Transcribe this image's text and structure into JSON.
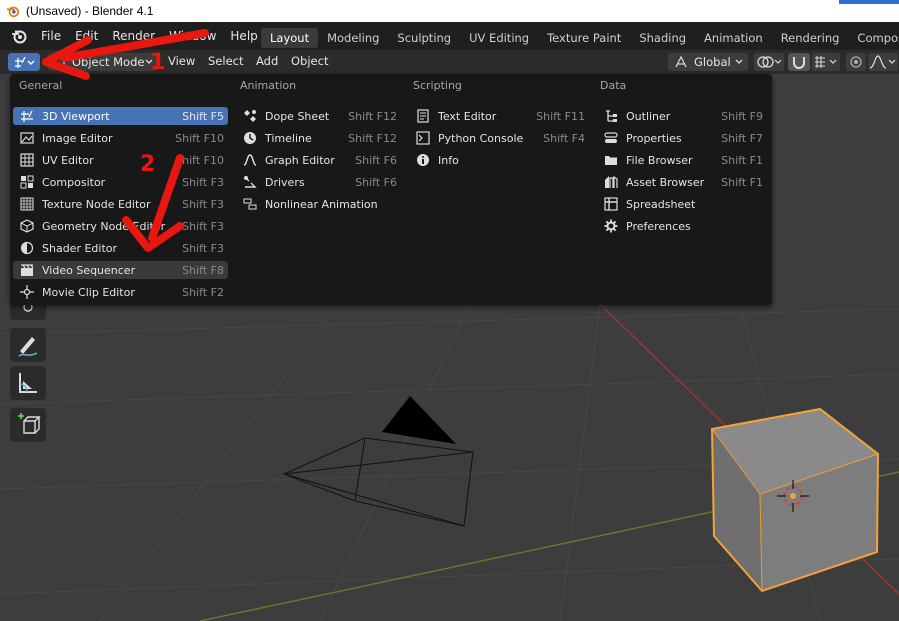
{
  "window": {
    "title": "(Unsaved) - Blender 4.1"
  },
  "topmenu": {
    "items": [
      "File",
      "Edit",
      "Render",
      "Window",
      "Help"
    ]
  },
  "workspaces": {
    "tabs": [
      "Layout",
      "Modeling",
      "Sculpting",
      "UV Editing",
      "Texture Paint",
      "Shading",
      "Animation",
      "Rendering",
      "Compositing"
    ],
    "active": "Layout"
  },
  "header3d": {
    "mode": "Object Mode",
    "menus": [
      "View",
      "Select",
      "Add",
      "Object"
    ],
    "orientation": "Global"
  },
  "editor_menu": {
    "columns": [
      {
        "title": "General",
        "items": [
          {
            "label": "3D Viewport",
            "shortcut": "Shift F5",
            "icon": "viewport-3d-icon",
            "state": "active"
          },
          {
            "label": "Image Editor",
            "shortcut": "Shift F10",
            "icon": "image-editor-icon"
          },
          {
            "label": "UV Editor",
            "shortcut": "Shift F10",
            "icon": "uv-editor-icon"
          },
          {
            "label": "Compositor",
            "shortcut": "Shift F3",
            "icon": "compositor-icon"
          },
          {
            "label": "Texture Node Editor",
            "shortcut": "Shift F3",
            "icon": "texture-node-icon"
          },
          {
            "label": "Geometry Node Editor",
            "shortcut": "Shift F3",
            "icon": "geometry-node-icon"
          },
          {
            "label": "Shader Editor",
            "shortcut": "Shift F3",
            "icon": "shader-editor-icon"
          },
          {
            "label": "Video Sequencer",
            "shortcut": "Shift F8",
            "icon": "video-sequencer-icon",
            "state": "hover"
          },
          {
            "label": "Movie Clip Editor",
            "shortcut": "Shift F2",
            "icon": "movie-clip-icon"
          }
        ]
      },
      {
        "title": "Animation",
        "items": [
          {
            "label": "Dope Sheet",
            "shortcut": "Shift F12",
            "icon": "dope-sheet-icon"
          },
          {
            "label": "Timeline",
            "shortcut": "Shift F12",
            "icon": "timeline-icon"
          },
          {
            "label": "Graph Editor",
            "shortcut": "Shift F6",
            "icon": "graph-editor-icon"
          },
          {
            "label": "Drivers",
            "shortcut": "Shift F6",
            "icon": "drivers-icon"
          },
          {
            "label": "Nonlinear Animation",
            "shortcut": "",
            "icon": "nla-icon"
          }
        ]
      },
      {
        "title": "Scripting",
        "items": [
          {
            "label": "Text Editor",
            "shortcut": "Shift F11",
            "icon": "text-editor-icon"
          },
          {
            "label": "Python Console",
            "shortcut": "Shift F4",
            "icon": "python-console-icon"
          },
          {
            "label": "Info",
            "shortcut": "",
            "icon": "info-icon"
          }
        ]
      },
      {
        "title": "Data",
        "items": [
          {
            "label": "Outliner",
            "shortcut": "Shift F9",
            "icon": "outliner-icon"
          },
          {
            "label": "Properties",
            "shortcut": "Shift F7",
            "icon": "properties-icon"
          },
          {
            "label": "File Browser",
            "shortcut": "Shift F1",
            "icon": "file-browser-icon"
          },
          {
            "label": "Asset Browser",
            "shortcut": "Shift F1",
            "icon": "asset-browser-icon"
          },
          {
            "label": "Spreadsheet",
            "shortcut": "",
            "icon": "spreadsheet-icon"
          },
          {
            "label": "Preferences",
            "shortcut": "",
            "icon": "preferences-icon"
          }
        ]
      }
    ]
  },
  "annotations": {
    "step1": "1",
    "step2": "2",
    "color": "#e8170f"
  },
  "colors": {
    "accent": "#4772b3",
    "selection": "#f5a236"
  }
}
